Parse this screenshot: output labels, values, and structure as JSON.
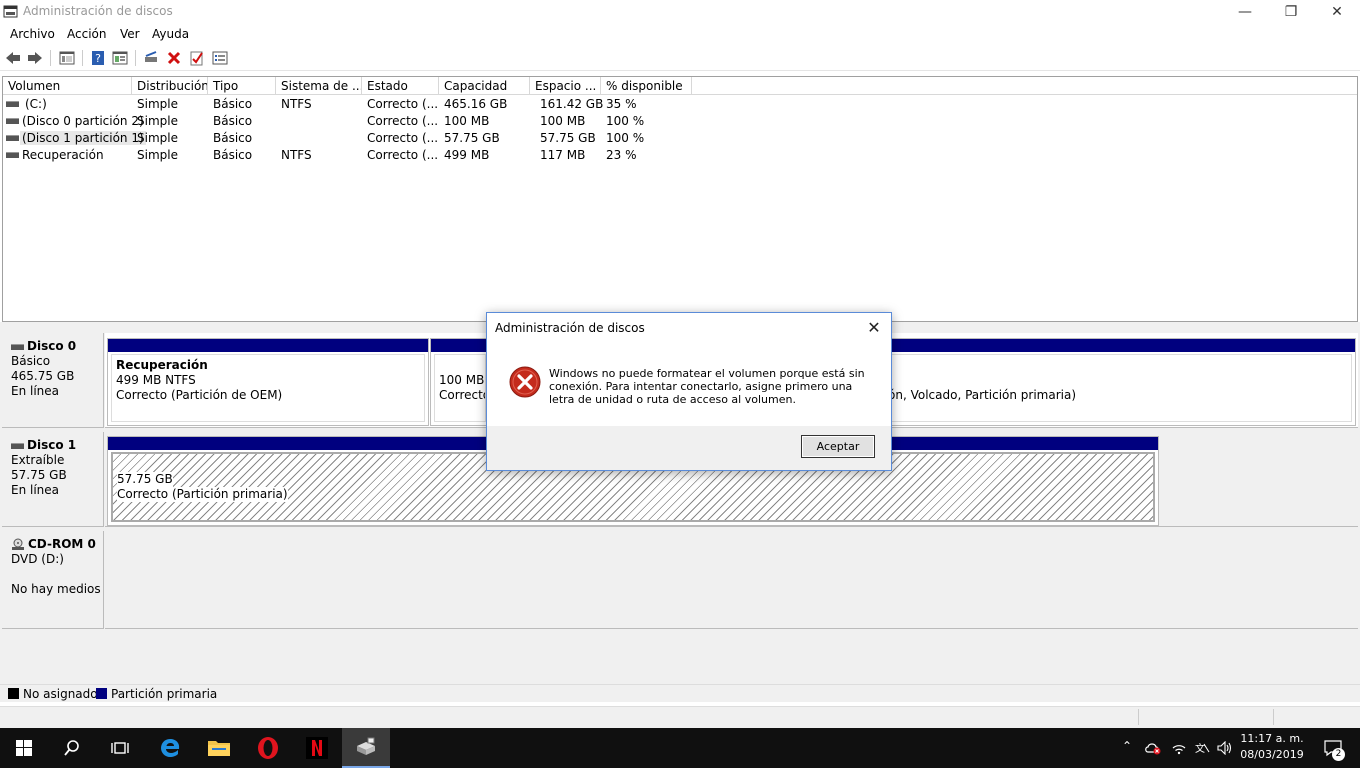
{
  "window": {
    "title": "Administración de discos"
  },
  "menu": [
    "Archivo",
    "Acción",
    "Ver",
    "Ayuda"
  ],
  "table": {
    "columns": [
      "Volumen",
      "Distribución",
      "Tipo",
      "Sistema de ...",
      "Estado",
      "Capacidad",
      "Espacio ...",
      "% disponible"
    ],
    "rows": [
      [
        "(C:)",
        "Simple",
        "Básico",
        "NTFS",
        "Correcto (...",
        "465.16 GB",
        "161.42 GB",
        "35 %"
      ],
      [
        "(Disco 0 partición 2)",
        "Simple",
        "Básico",
        "",
        "Correcto (...",
        "100 MB",
        "100 MB",
        "100 %"
      ],
      [
        "(Disco 1 partición 1)",
        "Simple",
        "Básico",
        "",
        "Correcto (...",
        "57.75 GB",
        "57.75 GB",
        "100 %"
      ],
      [
        "Recuperación",
        "Simple",
        "Básico",
        "NTFS",
        "Correcto (...",
        "499 MB",
        "117 MB",
        "23 %"
      ]
    ]
  },
  "disks": [
    {
      "name": "Disco 0",
      "type": "Básico",
      "size": "465.75 GB",
      "status": "En línea",
      "partitions": [
        {
          "title": "Recuperación",
          "line1": "499 MB NTFS",
          "line2": "Correcto (Partición de OEM)"
        },
        {
          "title": "",
          "line1": "100 MB",
          "line2": "Correcto"
        },
        {
          "title": "",
          "line1": "",
          "line2": "ón, Volcado, Partición primaria)"
        }
      ]
    },
    {
      "name": "Disco 1",
      "type": "Extraíble",
      "size": "57.75 GB",
      "status": "En línea",
      "partitions": [
        {
          "title": "",
          "line1": "57.75 GB",
          "line2": "Correcto (Partición primaria)"
        }
      ]
    },
    {
      "name": "CD-ROM 0",
      "type": "DVD (D:)",
      "size": "",
      "status": "No hay medios"
    }
  ],
  "legend": [
    {
      "label": "No asignado",
      "color": "#000000"
    },
    {
      "label": "Partición primaria",
      "color": "#00007f"
    }
  ],
  "dialog": {
    "title": "Administración de discos",
    "message": "Windows no puede formatear el volumen porque está sin conexión. Para intentar conectarlo, asigne primero una letra de unidad o ruta de acceso al volumen.",
    "ok_label": "Aceptar"
  },
  "taskbar": {
    "time": "11:17 a. m.",
    "date": "08/03/2019",
    "notifications": "2"
  },
  "colors": {
    "primary_partition": "#00007f",
    "dialog_border": "#5a8bd8",
    "taskbar": "#101010"
  }
}
